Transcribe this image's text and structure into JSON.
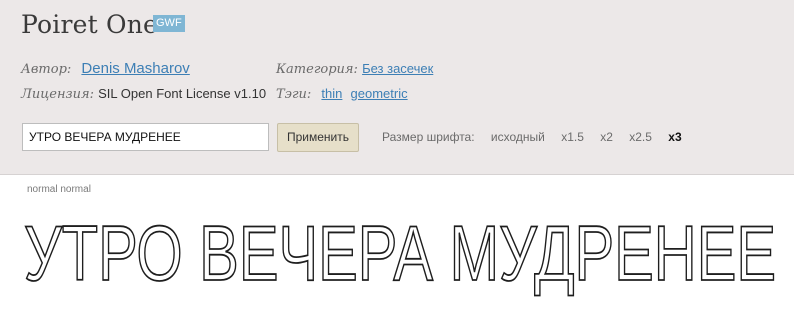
{
  "font": {
    "name": "Poiret One",
    "badge": "GWF"
  },
  "meta": {
    "author_label": "Автор:",
    "author": "Denis Masharov",
    "category_label": "Категория:",
    "category": "Без засечек",
    "license_label": "Лицензия:",
    "license": "SIL Open Font License v1.10",
    "tags_label": "Тэги:",
    "tags": [
      "thin",
      "geometric"
    ]
  },
  "controls": {
    "sample_text": "УТРО ВЕЧЕРА МУДРЕНЕЕ",
    "apply_label": "Применить",
    "size_label": "Размер шрифта:",
    "sizes": [
      "исходный",
      "x1.5",
      "x2",
      "x2.5",
      "x3"
    ],
    "active_size": "x3"
  },
  "preview": {
    "style_label": "normal normal",
    "text": "УТРО ВЕЧЕРА МУДРЕНЕЕ"
  },
  "colors": {
    "header_bg": "#ece8e8",
    "link": "#3d7fb5",
    "badge": "#7fb6d4",
    "button_bg": "#e6dfc9"
  }
}
